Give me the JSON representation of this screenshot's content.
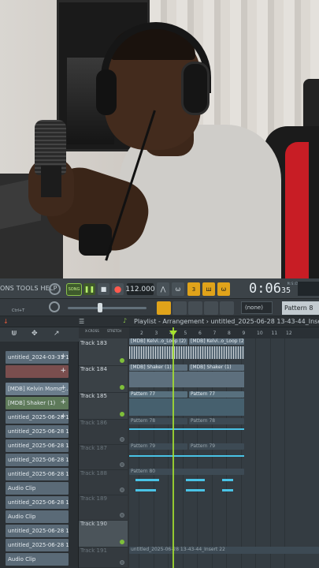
{
  "menu": {
    "label": "ONS TOOLS HELP"
  },
  "transport": {
    "song_label": "SONG",
    "tempo": "112.000",
    "clock_main": "0:06",
    "clock_sub": "35",
    "clock_unit": "M:S:CS"
  },
  "toolbar2": {
    "pattern_dropdown": "(none)",
    "pattern_name": "Pattern 8",
    "ctrl_hint": "Ctrl+T"
  },
  "playlist": {
    "title": "Playlist - Arrangement › untitled_2025-06-28 13-43-44_Insert 22"
  },
  "browser": {
    "items": [
      {
        "label": "untitled_2024-03-31 10-..."
      },
      {
        "label": ""
      },
      {
        "label": "[MDB] Kelvin Momo_..."
      },
      {
        "label": "[MDB] Shaker (1)"
      },
      {
        "label": "untitled_2025-06-28 13-..."
      },
      {
        "label": "untitled_2025-06-28 13-..."
      },
      {
        "label": "untitled_2025-06-28 13-..."
      },
      {
        "label": "untitled_2025-06-28 13-..."
      },
      {
        "label": "untitled_2025-06-28 13-..."
      },
      {
        "label": "Audio Clip"
      },
      {
        "label": "untitled_2025-06-28 13-..."
      },
      {
        "label": "Audio Clip"
      },
      {
        "label": "untitled_2025-06-28 13-..."
      },
      {
        "label": "untitled_2025-06-28 13-..."
      },
      {
        "label": "Audio Clip"
      }
    ]
  },
  "tracks": [
    {
      "label": "Track 183"
    },
    {
      "label": "Track 184"
    },
    {
      "label": "Track 185"
    },
    {
      "label": "Track 186"
    },
    {
      "label": "Track 187"
    },
    {
      "label": "Track 188"
    },
    {
      "label": "Track 189"
    },
    {
      "label": "Track 190"
    },
    {
      "label": "Track 191"
    }
  ],
  "ruler": {
    "ticks": [
      "2",
      "3",
      "4",
      "5",
      "6",
      "7",
      "8",
      "9",
      "10",
      "11",
      "12"
    ]
  },
  "clips": {
    "loop_a": "[MDB] Kelvi..o_Loop (2)",
    "loop_b": "[MDB] Kelvi..o_Loop (2)",
    "shaker_a": "[MDB] Shaker (1)",
    "shaker_b": "[MDB] Shaker (1)",
    "p77a": "Pattern 77",
    "p77b": "Pattern 77",
    "p78a": "Pattern 78",
    "p78b": "Pattern 78",
    "p79a": "Pattern 79",
    "p79b": "Pattern 79",
    "p80": "Pattern 80",
    "insert": "untitled_2025-06-28 13-43-44_Insert 22"
  },
  "header_labels": {
    "xcross": "X-CROSS",
    "stretch": "STRETCH"
  }
}
